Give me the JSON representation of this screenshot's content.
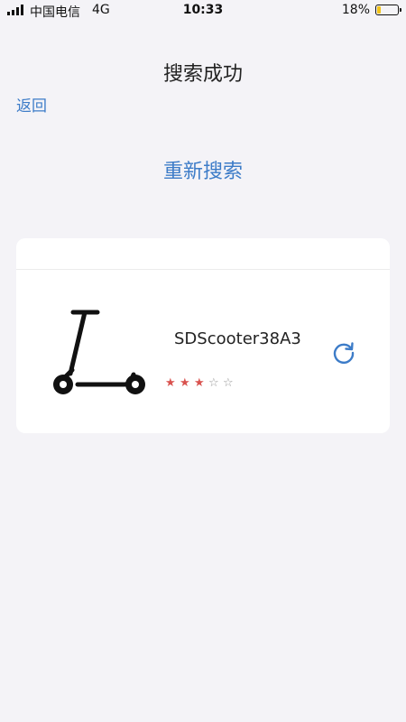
{
  "status_bar": {
    "carrier": "中国电信",
    "network": "4G",
    "time": "10:33",
    "battery_percent": "18%",
    "battery_level": 0.18,
    "battery_color": "#f2c318"
  },
  "header": {
    "title": "搜索成功",
    "back_label": "返回"
  },
  "rescan_label": "重新搜索",
  "device": {
    "icon": "scooter-icon",
    "name": "SDScooter38A3",
    "signal_rating": 3,
    "signal_rating_max": 5,
    "refresh_icon": "refresh-icon"
  },
  "colors": {
    "accent": "#3d7cc8",
    "star_filled": "#d9534f",
    "background": "#f4f3f7"
  }
}
